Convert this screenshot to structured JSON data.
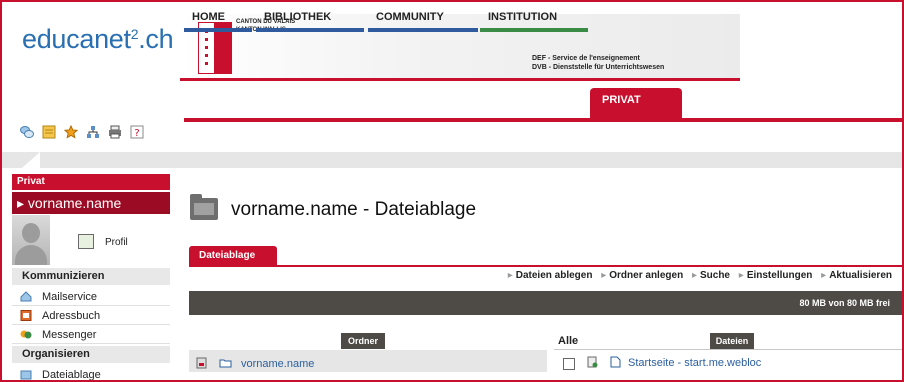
{
  "header": {
    "logo": "educanet",
    "logo_sup": "2",
    "logo_tail": ".ch",
    "canton_line1": "CANTON DU VALAIS",
    "canton_line2": "KANTON WALLIS",
    "service_line1": "DEF - Service de l'enseignement",
    "service_line2": "DVB - Dienststelle für Unterrichtswesen"
  },
  "nav": {
    "tabs": [
      {
        "label": "HOME",
        "underline": "#2f5b9e"
      },
      {
        "label": "BIBLIOTHEK",
        "underline": "#2f5b9e"
      },
      {
        "label": "COMMUNITY",
        "underline": "#2f5b9e"
      },
      {
        "label": "INSTITUTION",
        "underline": "#3a8b45"
      },
      {
        "label": "PRIVAT",
        "underline": "#c8102e"
      }
    ],
    "active": "PRIVAT",
    "accent": "#c8102e"
  },
  "toolbar": {
    "icons": [
      "chat-icon",
      "note-icon",
      "favorite-star-icon",
      "network-icon",
      "print-icon",
      "help-icon"
    ]
  },
  "sidebar": {
    "section_title": "Privat",
    "user": "vorname.name",
    "profile_label": "Profil",
    "communicate_title": "Kommunizieren",
    "communicate_items": [
      {
        "label": "Mailservice",
        "icon": "mail-icon"
      },
      {
        "label": "Adressbuch",
        "icon": "address-book-icon"
      },
      {
        "label": "Messenger",
        "icon": "messenger-icon"
      }
    ],
    "organize_title": "Organisieren",
    "organize_items": [
      {
        "label": "Dateiablage",
        "icon": "file-storage-icon"
      }
    ]
  },
  "main": {
    "title": "vorname.name - Dateiablage",
    "subtab": "Dateiablage",
    "actions": [
      "Dateien ablegen",
      "Ordner anlegen",
      "Suche",
      "Einstellungen",
      "Aktualisieren"
    ],
    "quota_text": "80 MB von 80 MB frei",
    "folders_header": "Ordner",
    "folder_item": "vorname.name",
    "all_label": "Alle",
    "files_header": "Dateien",
    "file_item": "Startseite - start.me.webloc"
  }
}
